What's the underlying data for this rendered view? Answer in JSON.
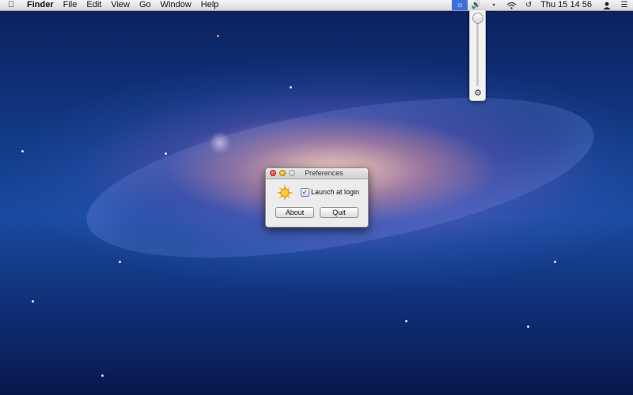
{
  "menubar": {
    "apple_icon": "apple-icon",
    "app_name": "Finder",
    "items": [
      "File",
      "Edit",
      "View",
      "Go",
      "Window",
      "Help"
    ],
    "status_icons": [
      "brightness-icon",
      "volume-icon",
      "bluetooth-icon",
      "wifi-icon",
      "time-machine-icon"
    ],
    "clock": "Thu 15 14 56",
    "user_icon": "user-icon",
    "menu_icon": "list-icon"
  },
  "brightness_slider": {
    "level": 1.0
  },
  "prefs_window": {
    "title": "Preferences",
    "launch_label": "Launch at login",
    "launch_checked": true,
    "about_label": "About",
    "quit_label": "Quit"
  },
  "colors": {
    "accent": "#3d6fd8"
  }
}
